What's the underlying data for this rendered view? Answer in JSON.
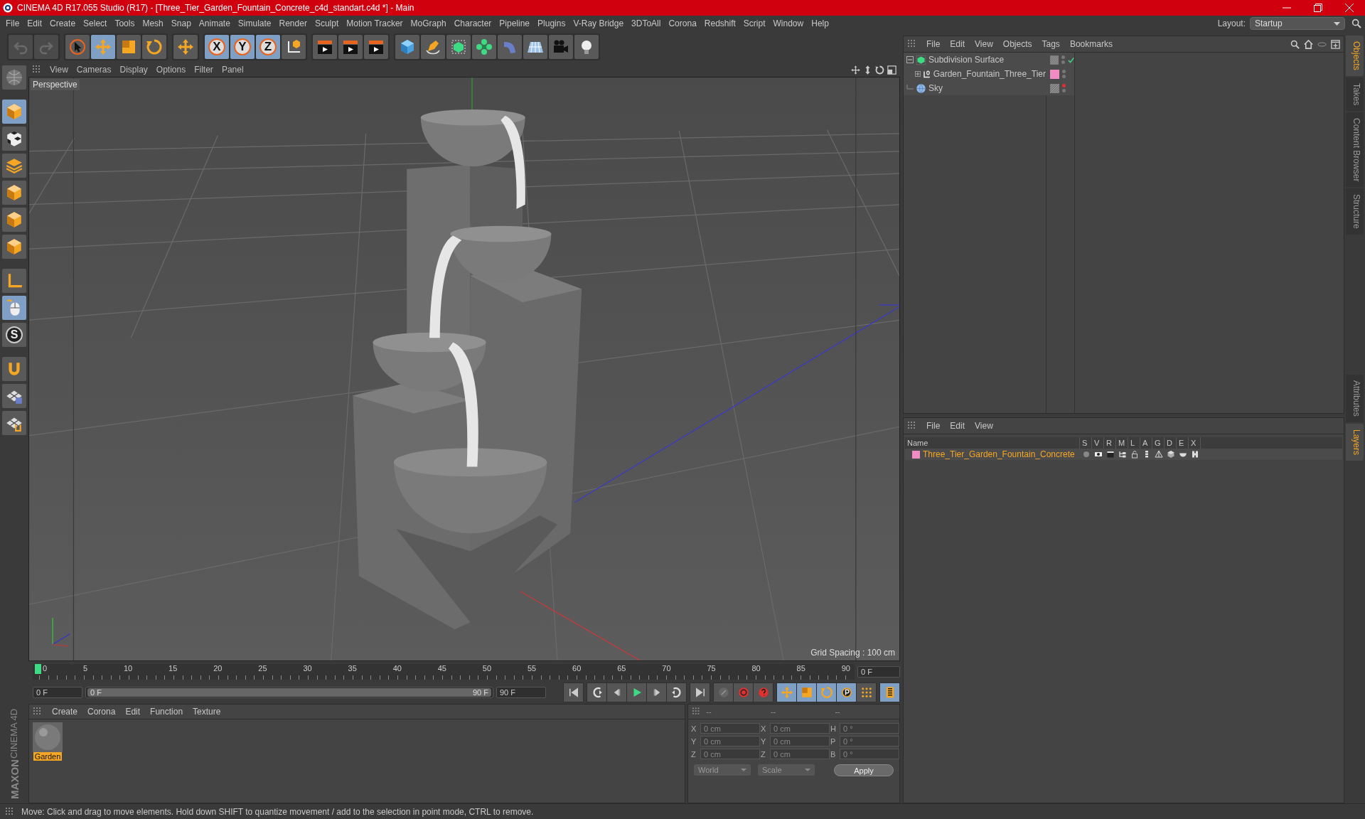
{
  "window": {
    "title": "CINEMA 4D R17.055 Studio (R17) - [Three_Tier_Garden_Fountain_Concrete_c4d_standart.c4d *] - Main"
  },
  "menu": [
    "File",
    "Edit",
    "Create",
    "Select",
    "Tools",
    "Mesh",
    "Snap",
    "Animate",
    "Simulate",
    "Render",
    "Sculpt",
    "Motion Tracker",
    "MoGraph",
    "Character",
    "Pipeline",
    "Plugins",
    "V-Ray Bridge",
    "3DToAll",
    "Corona",
    "Redshift",
    "Script",
    "Window",
    "Help"
  ],
  "layout": {
    "label": "Layout:",
    "value": "Startup"
  },
  "toolbar": {
    "axis_buttons": [
      {
        "label": "X",
        "selected": true
      },
      {
        "label": "Y",
        "selected": true
      },
      {
        "label": "Z",
        "selected": true
      }
    ]
  },
  "left_toolbar": {
    "s_button": "S"
  },
  "viewport": {
    "menu": [
      "View",
      "Cameras",
      "Display",
      "Options",
      "Filter",
      "Panel"
    ],
    "camera": "Perspective",
    "grid_spacing": "Grid Spacing : 100 cm"
  },
  "timeline": {
    "ticks": [
      "0",
      "5",
      "10",
      "15",
      "20",
      "25",
      "30",
      "35",
      "40",
      "45",
      "50",
      "55",
      "60",
      "65",
      "70",
      "75",
      "80",
      "85",
      "90"
    ],
    "current_frame": "0 F",
    "start_field": "0 F",
    "range": {
      "start": "0 F",
      "end": "90 F",
      "level": 1
    },
    "end_field": "90 F"
  },
  "materials": {
    "menu": [
      "Create",
      "Corona",
      "Edit",
      "Function",
      "Texture"
    ],
    "items": [
      {
        "name": "Garden",
        "selected": true
      }
    ]
  },
  "coordinates": {
    "headers": [
      "--",
      "--",
      "--"
    ],
    "rows": [
      {
        "position_label": "X",
        "position": "0 cm",
        "size_label": "X",
        "size": "0 cm",
        "rotation_label": "H",
        "rotation": "0 °"
      },
      {
        "position_label": "Y",
        "position": "0 cm",
        "size_label": "Y",
        "size": "0 cm",
        "rotation_label": "P",
        "rotation": "0 °"
      },
      {
        "position_label": "Z",
        "position": "0 cm",
        "size_label": "Z",
        "size": "0 cm",
        "rotation_label": "B",
        "rotation": "0 °"
      }
    ],
    "mode": "World",
    "size_mode": "Scale",
    "apply": "Apply"
  },
  "objects": {
    "menu": [
      "File",
      "Edit",
      "View",
      "Objects",
      "Tags",
      "Bookmarks"
    ],
    "items": [
      {
        "name": "Subdivision Surface",
        "kind": "subdivision",
        "expanded": true,
        "checked": true,
        "editor_visible": true,
        "children": [
          {
            "name": "Garden_Fountain_Three_Tier",
            "kind": "null",
            "expanded": false,
            "checked": false,
            "editor_visible": true,
            "color": "#f08cc4"
          }
        ]
      },
      {
        "name": "Sky",
        "kind": "sky",
        "checked": false,
        "editor_visible": false
      }
    ]
  },
  "layers": {
    "menu": [
      "File",
      "Edit",
      "View"
    ],
    "columns": [
      "Name",
      "S",
      "V",
      "R",
      "M",
      "L",
      "A",
      "G",
      "D",
      "E",
      "X"
    ],
    "rows": [
      {
        "name": "Three_Tier_Garden_Fountain_Concrete",
        "color": "#f08cc4"
      }
    ]
  },
  "side_tabs": {
    "top": [
      {
        "label": "Objects",
        "selected": true
      },
      {
        "label": "Takes",
        "selected": false
      },
      {
        "label": "Content Browser",
        "selected": false
      },
      {
        "label": "Structure",
        "selected": false
      }
    ],
    "bottom": [
      {
        "label": "Attributes",
        "selected": false
      },
      {
        "label": "Layers",
        "selected": true
      }
    ]
  },
  "logo": {
    "brand": "MAXON",
    "product": "CINEMA 4D"
  },
  "status_bar": "Move: Click and drag to move elements. Hold down SHIFT to quantize movement / add to the selection in point mode, CTRL to remove."
}
